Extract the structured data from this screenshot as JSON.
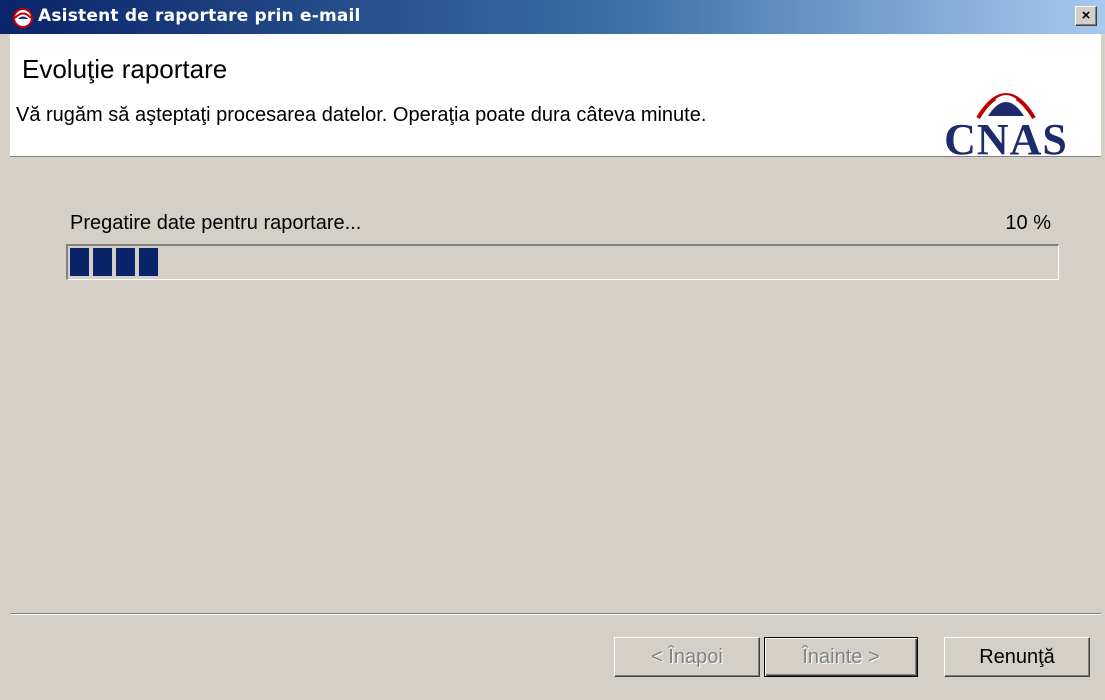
{
  "window": {
    "title": "Asistent de raportare prin e-mail",
    "close_label": "×"
  },
  "header": {
    "title": "Evoluţie raportare",
    "subtitle": "Vă rugăm să aşteptaţi procesarea datelor. Operaţia poate dura câteva minute.",
    "logo_text": "CNAS"
  },
  "progress": {
    "status": "Pregatire date pentru raportare...",
    "percent_label": "10 %",
    "value": 0.1
  },
  "buttons": {
    "back": "< Înapoi",
    "next": "Înainte >",
    "cancel": "Renunţă"
  },
  "colors": {
    "title_bar": "#0a246a",
    "progress_fill": "#0a246a",
    "logo": "#1d2a6b",
    "dialog_bg": "#d4d0c8"
  },
  "icons": {
    "app": "cnas-emblem-icon",
    "close": "close-icon"
  }
}
